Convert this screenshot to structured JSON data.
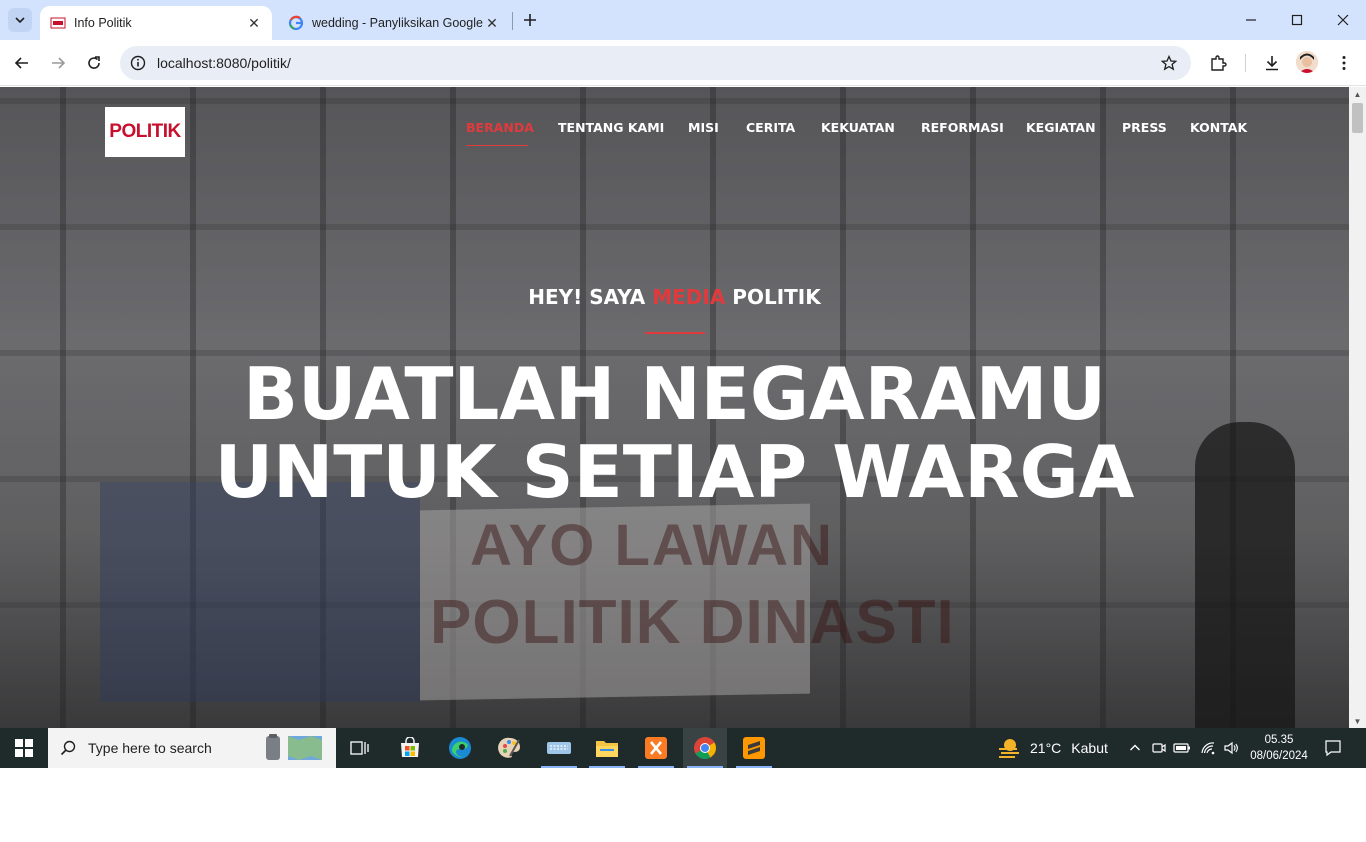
{
  "browser": {
    "tabs": [
      {
        "title": "Info Politik",
        "active": true
      },
      {
        "title": "wedding - Panyliksikan Google",
        "active": false
      }
    ],
    "url": "localhost:8080/politik/"
  },
  "site": {
    "logo_text": "POLITIK",
    "nav": [
      "BERANDA",
      "TENTANG KAMI",
      "MISI",
      "CERITA",
      "KEKUATAN",
      "REFORMASI",
      "KEGIATAN",
      "PRESS",
      "KONTAK"
    ],
    "active_nav": "BERANDA",
    "hero": {
      "kicker_pre": "HEY! SAYA ",
      "kicker_accent": "MEDIA",
      "kicker_post": " POLITIK",
      "headline_line1": "BUATLAH NEGARAMU",
      "headline_line2": "UNTUK SETIAP WARGA",
      "background_banner_line1": "AYO LAWAN",
      "background_banner_line2": "POLITIK DINASTI"
    },
    "accent_color": "#e03a3c"
  },
  "taskbar": {
    "search_placeholder": "Type here to search",
    "weather_temp": "21°C",
    "weather_desc": "Kabut",
    "time": "05.35",
    "date": "08/06/2024"
  }
}
